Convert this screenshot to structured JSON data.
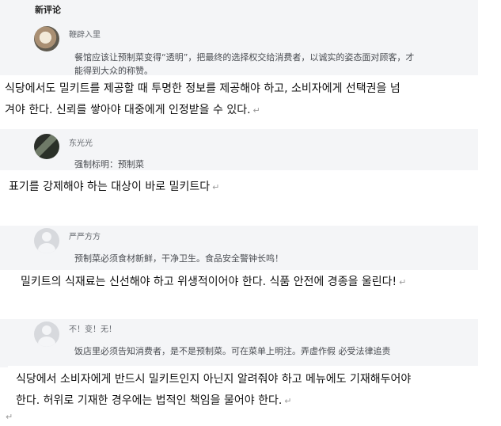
{
  "section_title": "新评论",
  "return_mark": "↵",
  "comments": [
    {
      "user": "鞭辟入里",
      "text_line1": "餐馆应该让预制菜变得“透明”，把最终的选择权交给消费者，以诚实的姿态面对顾客，才",
      "text_line2": "能得到大众的称赞。",
      "translation_line1": "식당에서도 밀키트를 제공할 때 투명한 정보를 제공해야 하고, 소비자에게 선택권을 넘",
      "translation_line2": "겨야 한다. 신뢰를 쌓아야 대중에게 인정받을 수 있다."
    },
    {
      "user": "东光光",
      "text_line1": "强制标明：预制菜",
      "translation_line1": "표기를 강제해야 하는 대상이 바로 밀키트다"
    },
    {
      "user": "严严方方",
      "text_line1": "预制菜必须食材新鲜，干净卫生。食品安全警钟长鸣！",
      "translation_line1": "밀키트의 식재료는 신선해야 하고 위생적이어야 한다. 식품 안전에 경종을 울린다!"
    },
    {
      "user": "不！变！无！",
      "text_line1": "饭店里必须告知消费者，是不是预制菜。可在菜单上明注。弄虚作假 必受法律追责",
      "translation_line1": "식당에서 소비자에게 반드시 밀키트인지 아닌지 알려줘야 하고 메뉴에도 기재해두어야",
      "translation_line2": "한다. 허위로 기재한 경우에는 법적인 책임을 물어야 한다."
    }
  ]
}
